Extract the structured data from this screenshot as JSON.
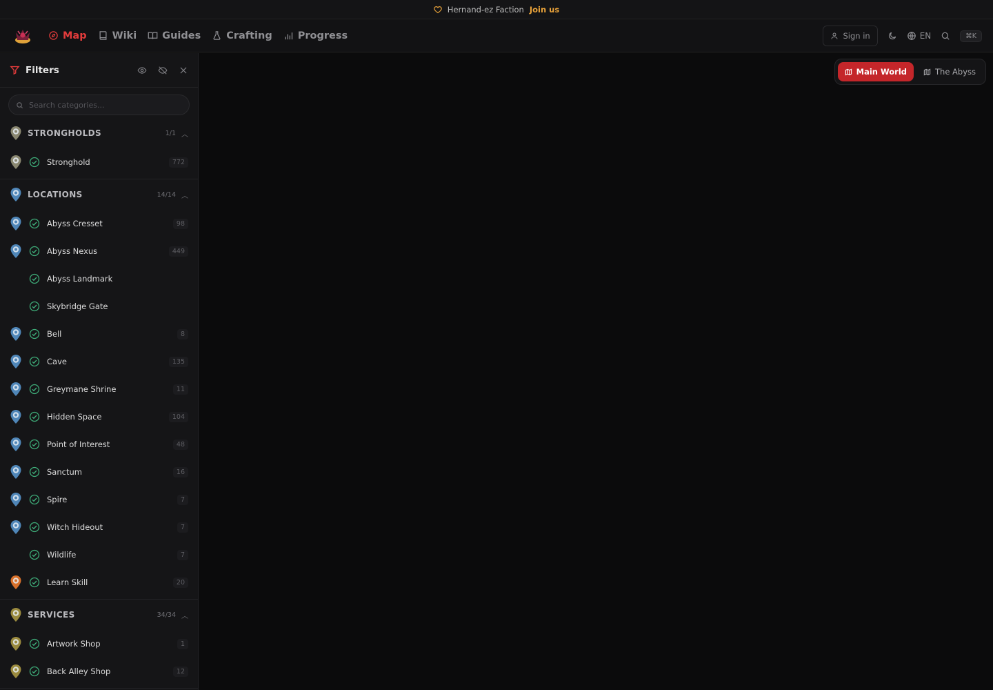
{
  "announcement": {
    "text": "Hernand-ez Faction",
    "link": "Join us"
  },
  "nav": {
    "items": [
      {
        "label": "Map",
        "icon": "compass-icon",
        "active": true
      },
      {
        "label": "Wiki",
        "icon": "book-icon",
        "active": false
      },
      {
        "label": "Guides",
        "icon": "open-book-icon",
        "active": false
      },
      {
        "label": "Crafting",
        "icon": "flask-icon",
        "active": false
      },
      {
        "label": "Progress",
        "icon": "bar-chart-icon",
        "active": false
      }
    ],
    "signin": "Sign in",
    "language": "EN",
    "shortcut": "⌘K"
  },
  "sidebar": {
    "title": "Filters",
    "search_placeholder": "Search categories...",
    "groups": [
      {
        "title": "STRONGHOLDS",
        "count": "1/1",
        "pin_color": "#8a8770",
        "items": [
          {
            "label": "Stronghold",
            "count": "772",
            "pin": true
          }
        ]
      },
      {
        "title": "LOCATIONS",
        "count": "14/14",
        "pin_color": "#4f86b8",
        "items": [
          {
            "label": "Abyss Cresset",
            "count": "98",
            "pin": true
          },
          {
            "label": "Abyss Nexus",
            "count": "449",
            "pin": true
          },
          {
            "label": "Abyss Landmark",
            "count": "",
            "pin": false
          },
          {
            "label": "Skybridge Gate",
            "count": "",
            "pin": false
          },
          {
            "label": "Bell",
            "count": "8",
            "pin": true
          },
          {
            "label": "Cave",
            "count": "135",
            "pin": true
          },
          {
            "label": "Greymane Shrine",
            "count": "11",
            "pin": true
          },
          {
            "label": "Hidden Space",
            "count": "104",
            "pin": true
          },
          {
            "label": "Point of Interest",
            "count": "48",
            "pin": true
          },
          {
            "label": "Sanctum",
            "count": "16",
            "pin": true
          },
          {
            "label": "Spire",
            "count": "7",
            "pin": true
          },
          {
            "label": "Witch Hideout",
            "count": "7",
            "pin": true
          },
          {
            "label": "Wildlife",
            "count": "7",
            "pin": false
          },
          {
            "label": "Learn Skill",
            "count": "20",
            "pin": true,
            "pin_color": "#d8702a"
          }
        ]
      },
      {
        "title": "SERVICES",
        "count": "34/34",
        "pin_color": "#9a8a3e",
        "items": [
          {
            "label": "Artwork Shop",
            "count": "1",
            "pin": true
          },
          {
            "label": "Back Alley Shop",
            "count": "12",
            "pin": true
          }
        ]
      }
    ]
  },
  "world_switch": {
    "main": "Main World",
    "abyss": "The Abyss"
  },
  "colors": {
    "accent": "#e23b3b",
    "check": "#3fae7a"
  }
}
